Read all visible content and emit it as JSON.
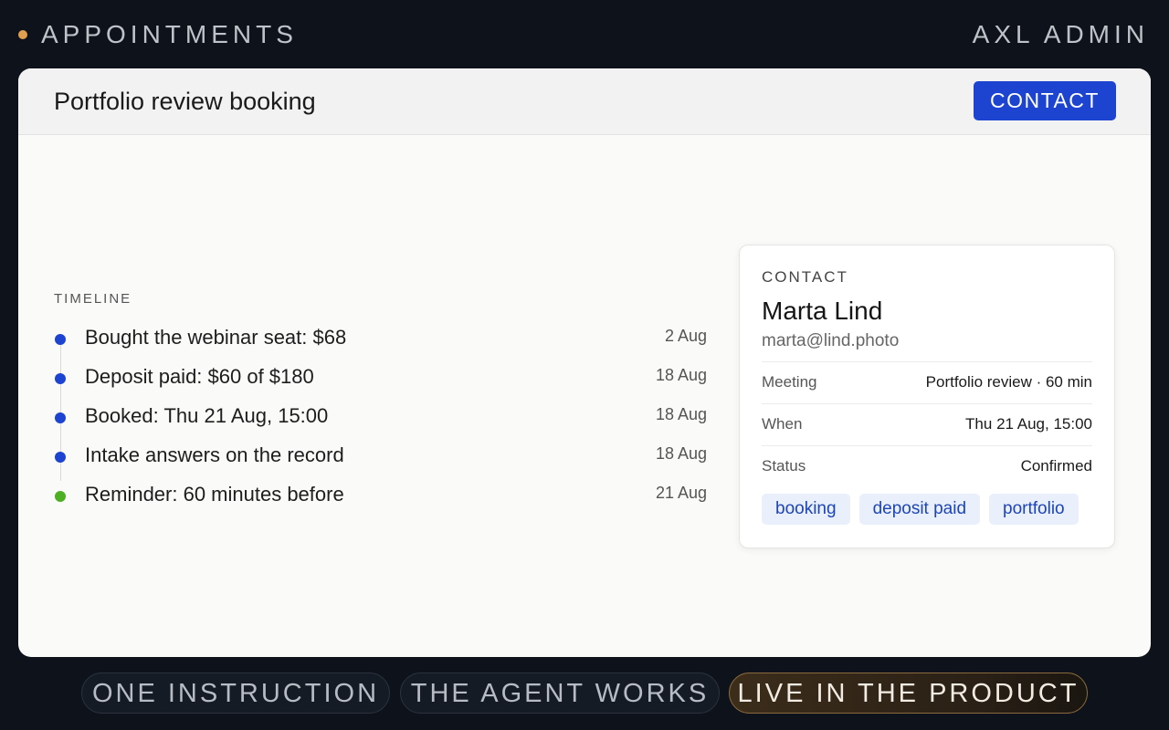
{
  "topbar": {
    "section": "APPOINTMENTS",
    "brand": "AXL ADMIN",
    "accent_color": "#e0a050"
  },
  "panel": {
    "title": "Portfolio review booking",
    "contact_button": "CONTACT"
  },
  "timeline": {
    "label": "TIMELINE",
    "items": [
      {
        "text": "Bought the webinar seat: $68",
        "date": "2 Aug",
        "color": "#1c44d1"
      },
      {
        "text": "Deposit paid: $60 of $180",
        "date": "18 Aug",
        "color": "#1c44d1"
      },
      {
        "text": "Booked: Thu 21 Aug, 15:00",
        "date": "18 Aug",
        "color": "#1c44d1"
      },
      {
        "text": "Intake answers on the record",
        "date": "18 Aug",
        "color": "#1c44d1"
      },
      {
        "text": "Reminder: 60 minutes before",
        "date": "21 Aug",
        "color": "#4caf24"
      }
    ]
  },
  "contact_card": {
    "kicker": "CONTACT",
    "name": "Marta Lind",
    "email": "marta@lind.photo",
    "rows": [
      {
        "label": "Meeting",
        "value": "Portfolio review · 60 min"
      },
      {
        "label": "When",
        "value": "Thu 21 Aug, 15:00"
      },
      {
        "label": "Status",
        "value": "Confirmed"
      }
    ],
    "tags": [
      "booking",
      "deposit paid",
      "portfolio"
    ]
  },
  "steps": {
    "items": [
      "ONE INSTRUCTION",
      "THE AGENT WORKS",
      "LIVE IN THE PRODUCT"
    ],
    "active": "LIVE IN THE PRODUCT"
  }
}
